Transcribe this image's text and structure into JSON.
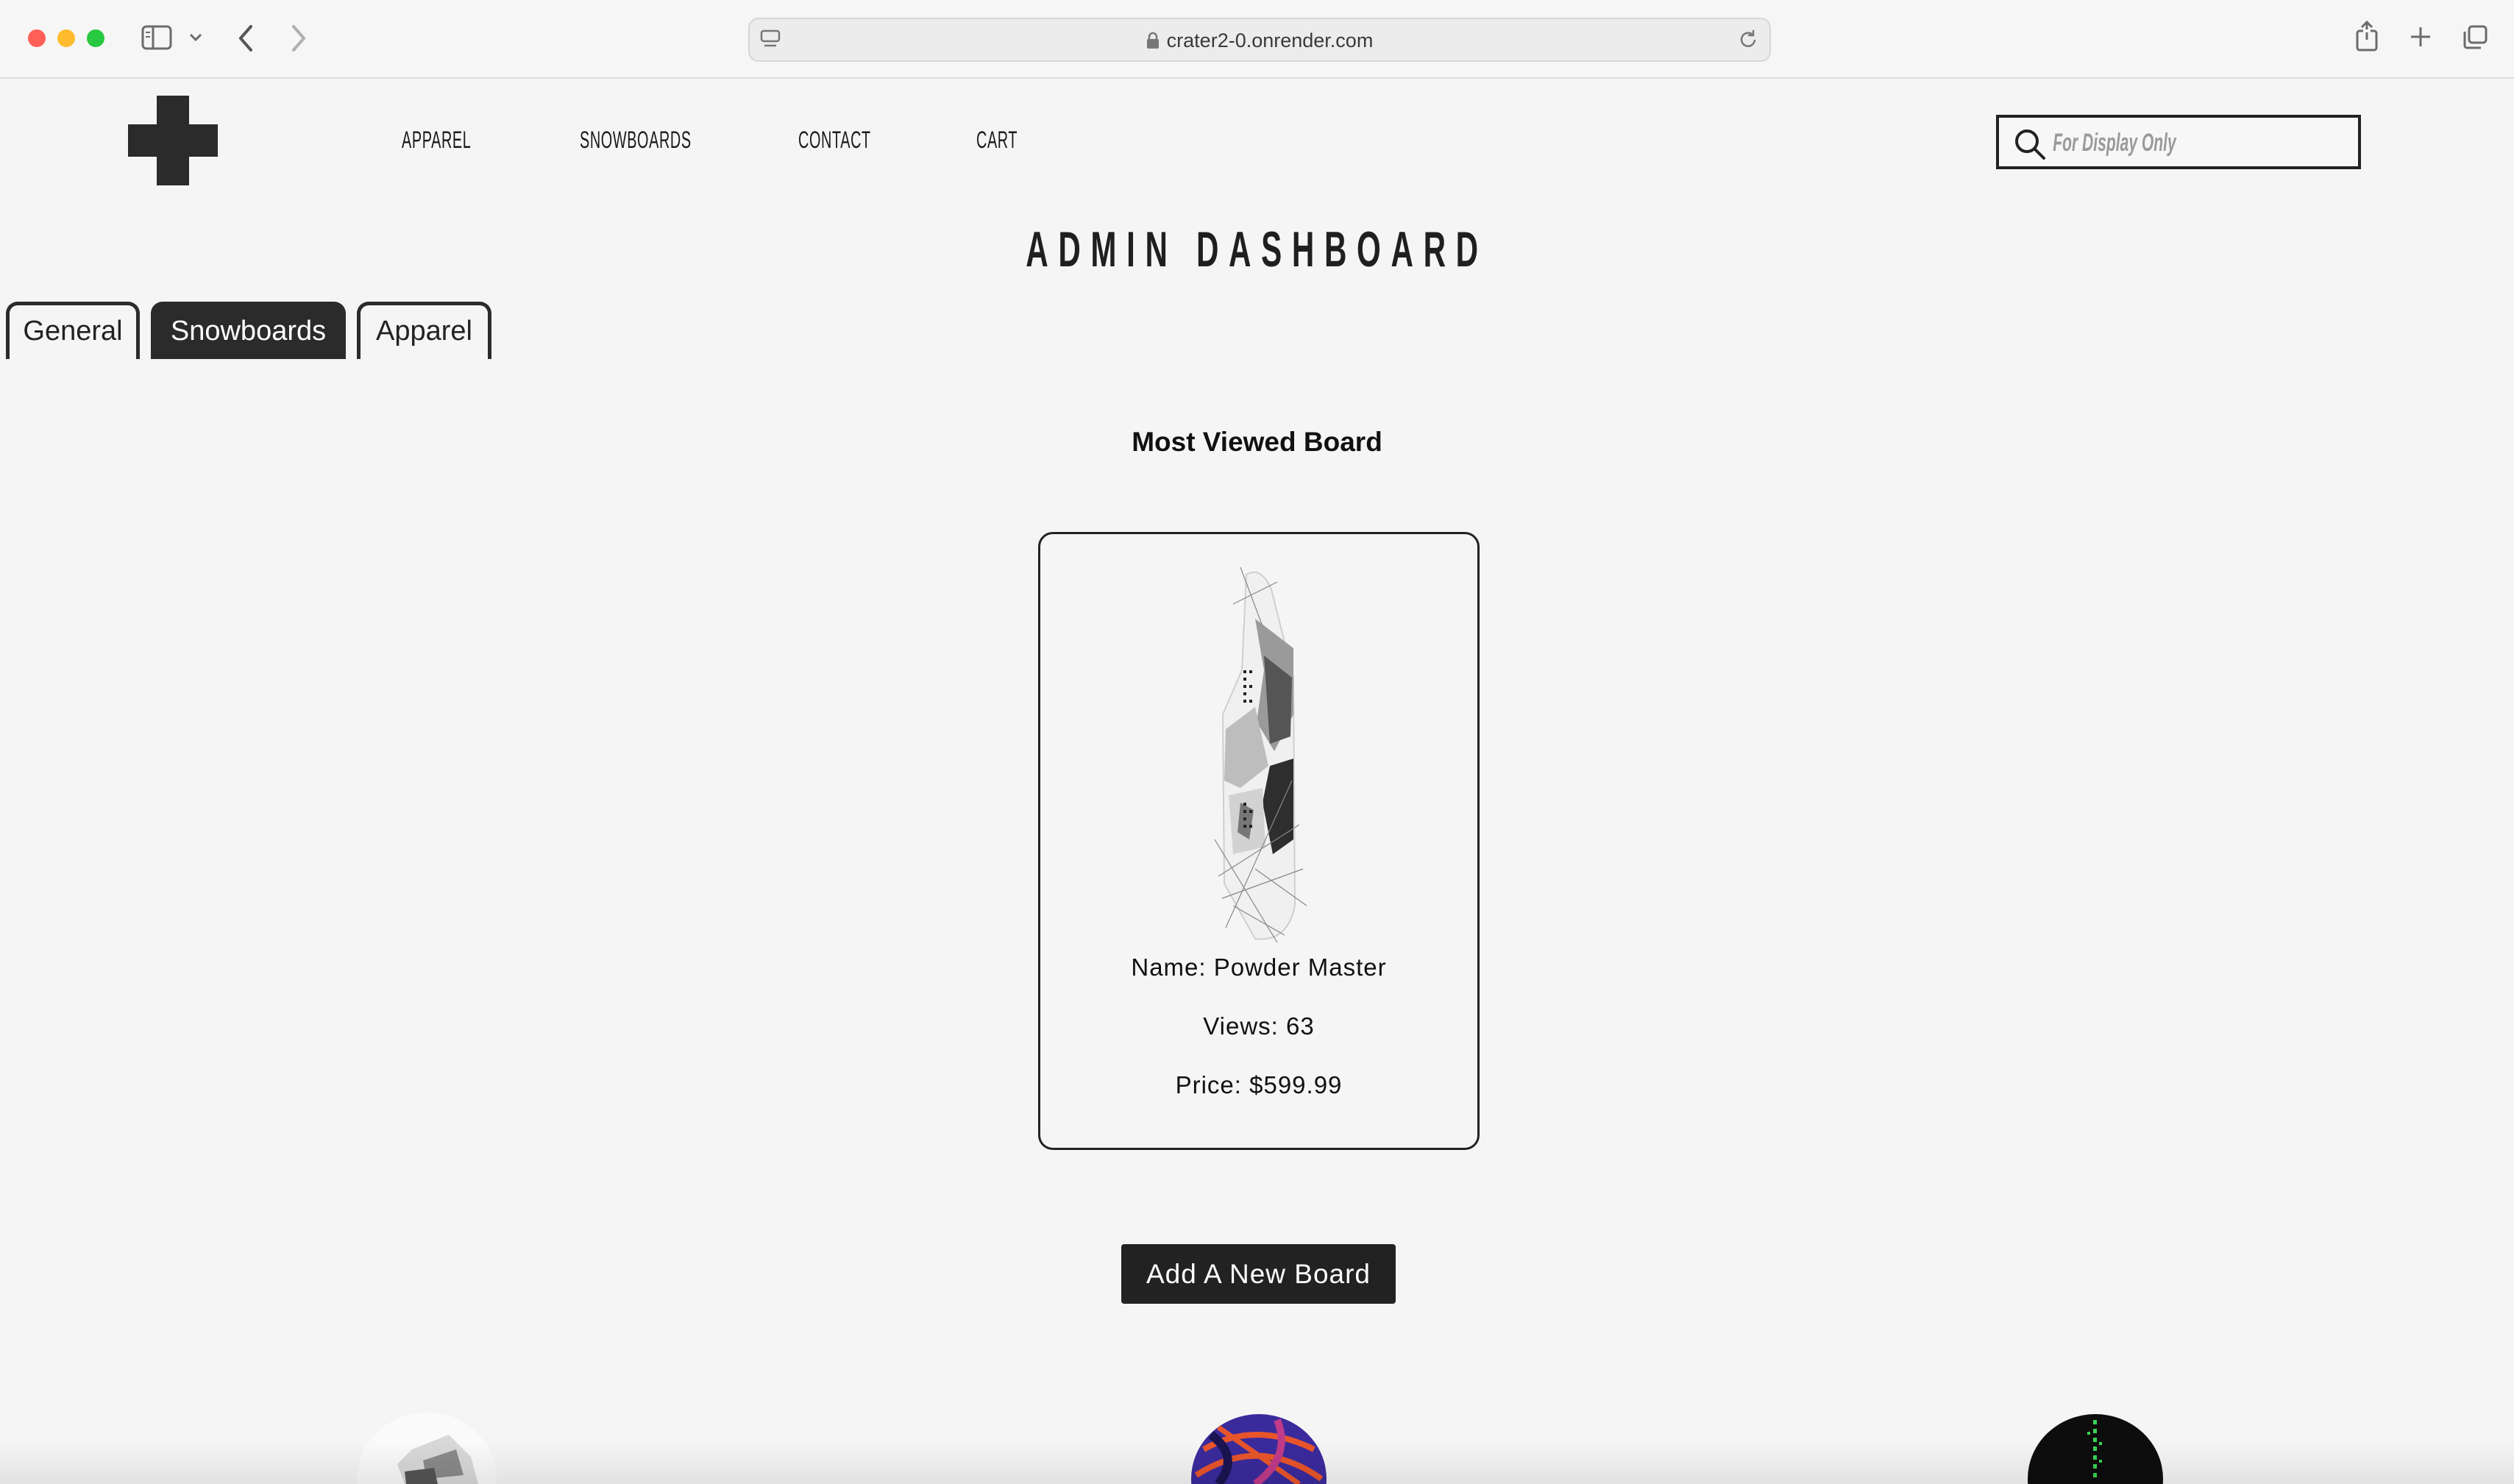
{
  "browser": {
    "url": "crater2-0.onrender.com"
  },
  "nav": {
    "items": [
      "APPAREL",
      "SNOWBOARDS",
      "CONTACT",
      "CART"
    ],
    "search_placeholder": "For Display Only"
  },
  "page": {
    "title": "ADMIN DASHBOARD",
    "tabs": [
      {
        "label": "General",
        "active": false
      },
      {
        "label": "Snowboards",
        "active": true
      },
      {
        "label": "Apparel",
        "active": false
      }
    ]
  },
  "most_viewed": {
    "heading": "Most Viewed Board",
    "name_line": "Name: Powder Master",
    "views_line": "Views: 63",
    "price_line": "Price: $599.99"
  },
  "actions": {
    "add_board_label": "Add A New Board"
  },
  "colors": {
    "background": "#f5f5f5",
    "dark": "#2b2b2b",
    "accent_green": "#39d353",
    "accent_orange": "#e8552b",
    "accent_purple": "#3b2a9c"
  }
}
